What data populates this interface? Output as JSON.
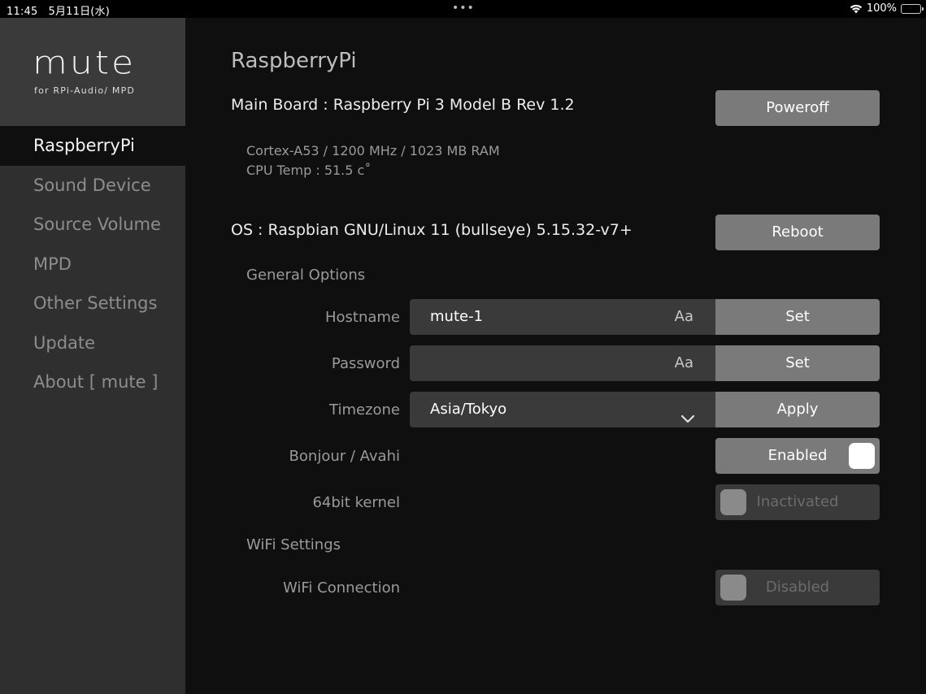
{
  "status_bar": {
    "time": "11:45",
    "date": "5月11日(水)",
    "dots": "•••",
    "battery": "100%",
    "icons": [
      "wifi-icon",
      "battery-charging-icon"
    ]
  },
  "sidebar": {
    "logo": "mute",
    "logo_sub": "for RPi-Audio/ MPD",
    "items": [
      {
        "label": "RaspberryPi",
        "active": true
      },
      {
        "label": "Sound Device",
        "active": false
      },
      {
        "label": "Source Volume",
        "active": false
      },
      {
        "label": "MPD",
        "active": false
      },
      {
        "label": "Other Settings",
        "active": false
      },
      {
        "label": "Update",
        "active": false
      },
      {
        "label": "About [ mute ]",
        "active": false
      }
    ]
  },
  "main": {
    "title": "RaspberryPi",
    "board": "Main Board : Raspberry Pi 3 Model B Rev 1.2",
    "poweroff_label": "Poweroff",
    "cpu_info": "Cortex-A53 / 1200 MHz / 1023 MB RAM",
    "cpu_temp": "CPU Temp : 51.5 c˚",
    "os": "OS : Raspbian GNU/Linux 11 (bullseye) 5.15.32-v7+",
    "reboot_label": "Reboot",
    "general_options": "General Options",
    "hostname": {
      "label": "Hostname",
      "value": "mute-1",
      "aa": "Aa",
      "button": "Set"
    },
    "password": {
      "label": "Password",
      "value": "",
      "aa": "Aa",
      "button": "Set"
    },
    "timezone": {
      "label": "Timezone",
      "value": "Asia/Tokyo",
      "button": "Apply"
    },
    "bonjour": {
      "label": "Bonjour / Avahi",
      "state": "Enabled"
    },
    "kernel64": {
      "label": "64bit kernel",
      "state": "Inactivated"
    },
    "wifi_settings": "WiFi Settings",
    "wifi_connection": {
      "label": "WiFi Connection",
      "state": "Disabled"
    }
  },
  "colors": {
    "sidebar_bg": "#2f2f2f",
    "main_bg": "#0f0f0f",
    "button_bg": "#7a7a7a",
    "field_bg": "#3a3a3a",
    "battery": "#4cd964"
  }
}
